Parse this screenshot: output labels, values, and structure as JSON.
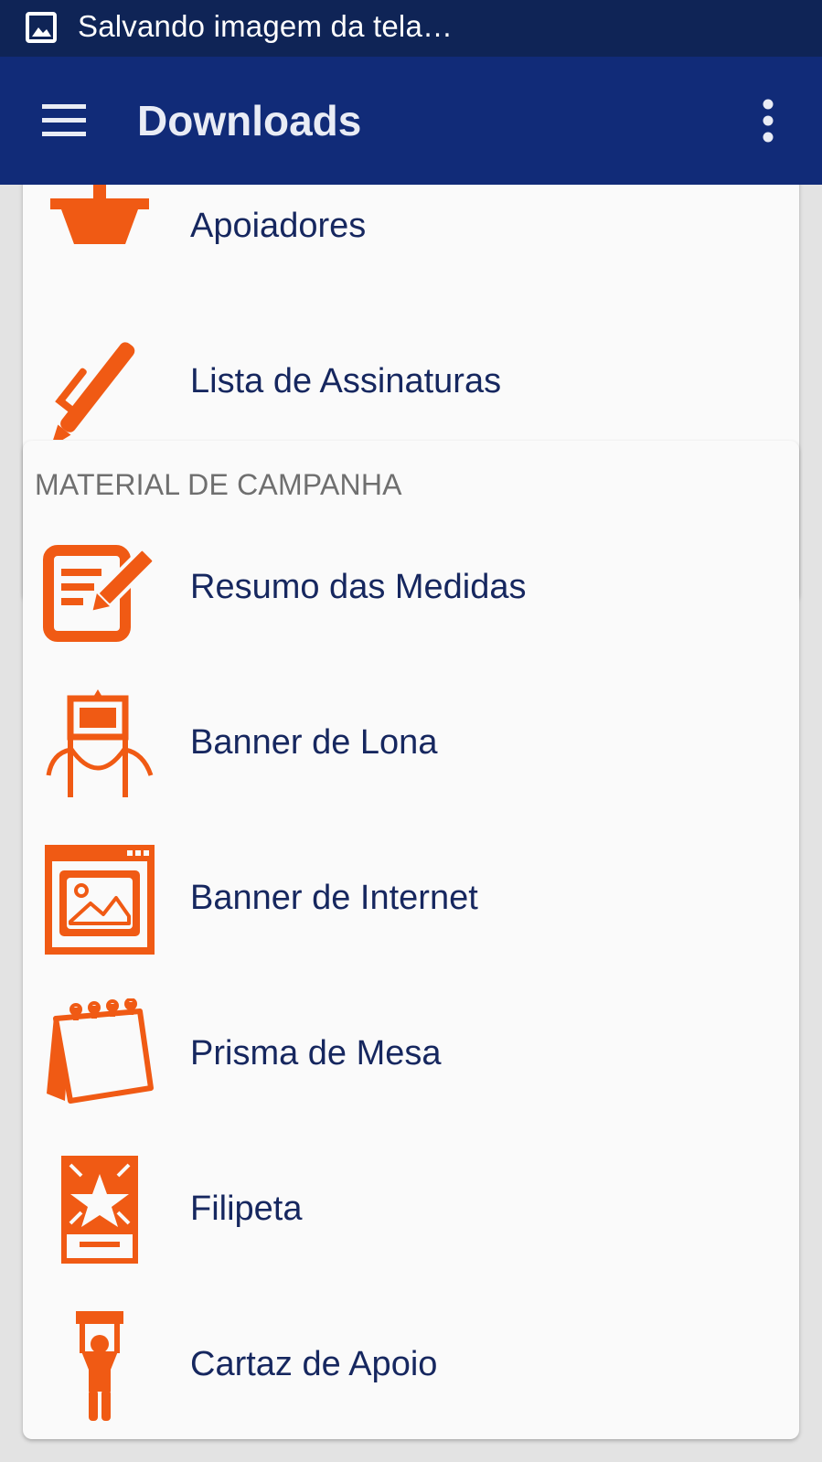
{
  "status_bar": {
    "text": "Salvando imagem da tela…",
    "icon": "image-icon"
  },
  "app_bar": {
    "title": "Downloads",
    "menu_icon": "hamburger-menu-icon",
    "more_icon": "more-vertical-icon"
  },
  "colors": {
    "status_bar": "#0f2456",
    "app_bar": "#112b78",
    "accent": "#f05a14",
    "item_text": "#16275f",
    "section_text": "#6f6f6f"
  },
  "top_card": {
    "items": [
      {
        "label": "Apoiadores",
        "icon": "ballot-box-icon"
      },
      {
        "label": "Lista de Assinaturas",
        "icon": "pen-icon"
      }
    ]
  },
  "campaign_card": {
    "header": "MATERIAL DE CAMPANHA",
    "items": [
      {
        "label": "Resumo das Medidas",
        "icon": "document-edit-icon"
      },
      {
        "label": "Banner de Lona",
        "icon": "stanchion-banner-icon"
      },
      {
        "label": "Banner de Internet",
        "icon": "browser-image-icon"
      },
      {
        "label": "Prisma de Mesa",
        "icon": "desk-calendar-icon"
      },
      {
        "label": "Filipeta",
        "icon": "star-flyer-icon"
      },
      {
        "label": "Cartaz de Apoio",
        "icon": "person-holding-sign-icon"
      }
    ]
  }
}
